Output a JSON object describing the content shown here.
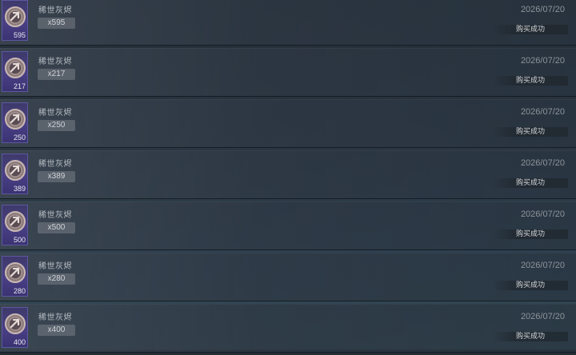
{
  "records": [
    {
      "icon_count": "595",
      "item_name": "稀世灰烬",
      "qty": "x595",
      "date": "2026/07/20",
      "status": "购买成功"
    },
    {
      "icon_count": "217",
      "item_name": "稀世灰烬",
      "qty": "x217",
      "date": "2026/07/20",
      "status": "购买成功"
    },
    {
      "icon_count": "250",
      "item_name": "稀世灰烬",
      "qty": "x250",
      "date": "2026/07/20",
      "status": "购买成功"
    },
    {
      "icon_count": "389",
      "item_name": "稀世灰烬",
      "qty": "x389",
      "date": "2026/07/20",
      "status": "购买成功"
    },
    {
      "icon_count": "500",
      "item_name": "稀世灰烬",
      "qty": "x500",
      "date": "2026/07/20",
      "status": "购买成功"
    },
    {
      "icon_count": "280",
      "item_name": "稀世灰烬",
      "qty": "x280",
      "date": "2026/07/20",
      "status": "购买成功"
    },
    {
      "icon_count": "400",
      "item_name": "稀世灰烬",
      "qty": "x400",
      "date": "2026/07/20",
      "status": "购买成功"
    }
  ],
  "item_icon": "ash-coin-icon"
}
